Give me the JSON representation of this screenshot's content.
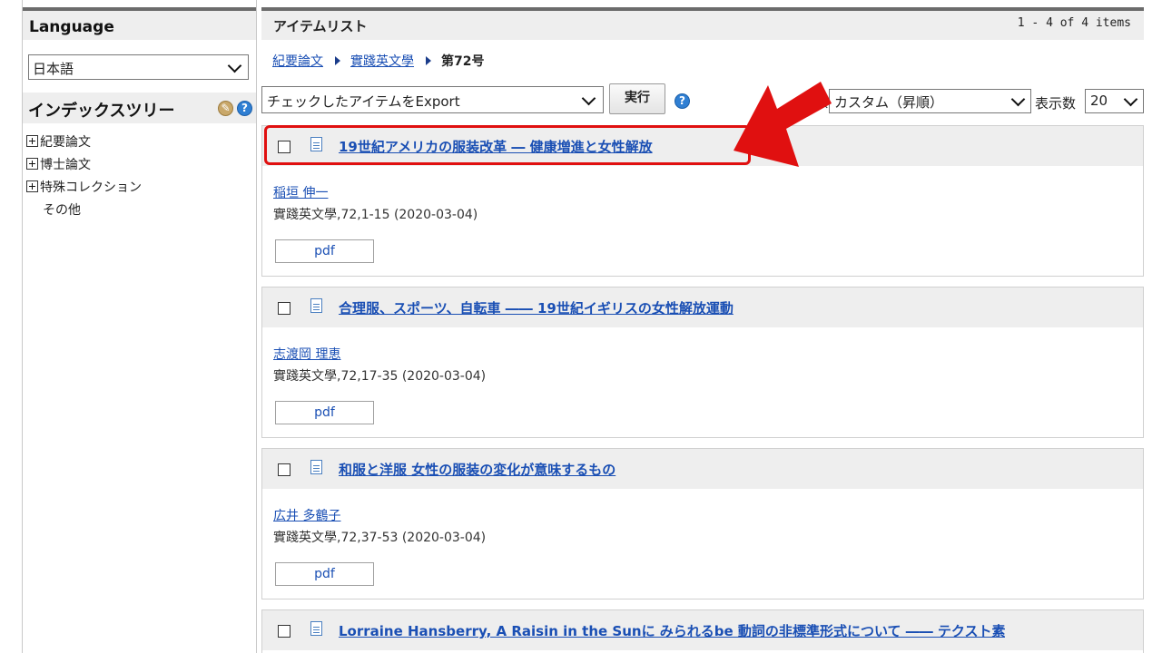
{
  "sidebar": {
    "language_header": "Language",
    "language_value": "日本語",
    "index_tree_header": "インデックスツリー",
    "tree_items": [
      {
        "label": "紀要論文",
        "expandable": true
      },
      {
        "label": "博士論文",
        "expandable": true
      },
      {
        "label": "特殊コレクション",
        "expandable": true
      },
      {
        "label": "その他",
        "expandable": false
      }
    ]
  },
  "main": {
    "title": "アイテムリスト",
    "count": "1 - 4 of 4 items",
    "breadcrumb": {
      "items": [
        "紀要論文",
        "實踐英文學"
      ],
      "current": "第72号"
    },
    "toolbar": {
      "export_value": "チェックしたアイテムをExport",
      "run_label": "実行",
      "sort_label": "順",
      "sort_value": "カスタム（昇順）",
      "perpage_label": "表示数",
      "perpage_value": "20"
    },
    "items": [
      {
        "title": "19世紀アメリカの服装改革 ― 健康増進と女性解放",
        "author": "稲垣 伸一",
        "meta": "實踐英文學,72,1-15 (2020-03-04)",
        "pdf": "pdf"
      },
      {
        "title": "合理服、スポーツ、自転車 ―― 19世紀イギリスの女性解放運動",
        "author": "志渡岡 理恵",
        "meta": "實踐英文學,72,17-35 (2020-03-04)",
        "pdf": "pdf"
      },
      {
        "title": "和服と洋服 女性の服装の変化が意味するもの",
        "author": "広井 多鶴子",
        "meta": "實踐英文學,72,37-53 (2020-03-04)",
        "pdf": "pdf"
      },
      {
        "title": "Lorraine Hansberry, A Raisin in the Sunに みられるbe 動詞の非標準形式について ―― テクスト素",
        "author": "",
        "meta": "",
        "pdf": ""
      }
    ]
  },
  "colors": {
    "link": "#1a4fb4",
    "highlight": "#e01010",
    "header_bg": "#eeeeee"
  },
  "icons": {
    "tool": "wrench-icon",
    "help": "question-icon",
    "doc": "document-icon"
  }
}
